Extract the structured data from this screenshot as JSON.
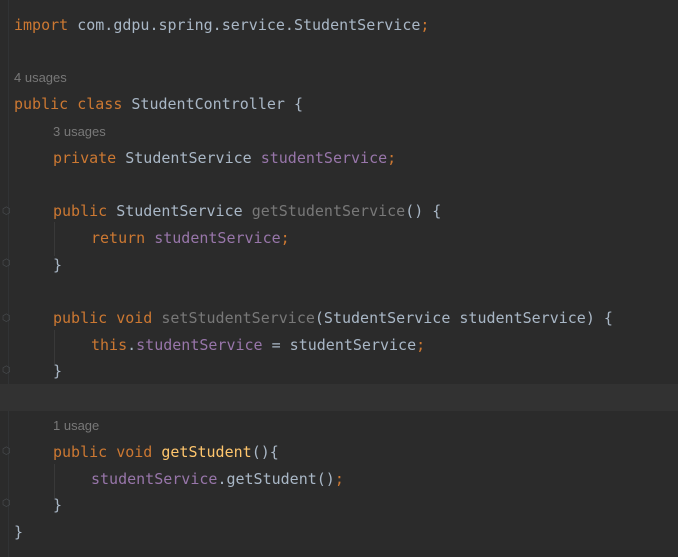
{
  "colors": {
    "background": "#2b2b2b",
    "keyword": "#cc7832",
    "field": "#9876aa",
    "method_declaration": "#ffc66d",
    "unused_method": "#787878",
    "plain": "#a9b7c6",
    "hint": "#787878"
  },
  "code": {
    "import": {
      "kw": "import",
      "path": " com.gdpu.spring.service.StudentService",
      "semi": ";"
    },
    "class_usages": "4 usages",
    "class_decl": {
      "kw1": "public",
      "kw2": " class",
      "name": " StudentController {"
    },
    "field_usages": "3 usages",
    "field_decl": {
      "kw": "private",
      "type": " StudentService ",
      "name": "studentService",
      "semi": ";"
    },
    "getter_decl": {
      "kw": "public",
      "type": " StudentService ",
      "name": "getStudentService",
      "rest": "() {"
    },
    "getter_body": {
      "kw": "return",
      "name": " studentService",
      "semi": ";"
    },
    "getter_close": "}",
    "setter_decl": {
      "kw1": "public",
      "kw2": " void ",
      "name": "setStudentService",
      "rest": "(StudentService studentService) {"
    },
    "setter_body": {
      "kw": "this",
      "dot": ".",
      "name": "studentService",
      "rest": " = studentService",
      "semi": ";"
    },
    "setter_close": "}",
    "method_usages": "1 usage",
    "method_decl": {
      "kw1": "public",
      "kw2": " void ",
      "name": "getStudent",
      "rest": "(){"
    },
    "method_body": {
      "obj": "studentService",
      "rest": ".getStudent()",
      "semi": ";"
    },
    "method_close": "}",
    "class_close": "}"
  },
  "icons": [
    "fold-start-icon",
    "fold-end-icon"
  ]
}
